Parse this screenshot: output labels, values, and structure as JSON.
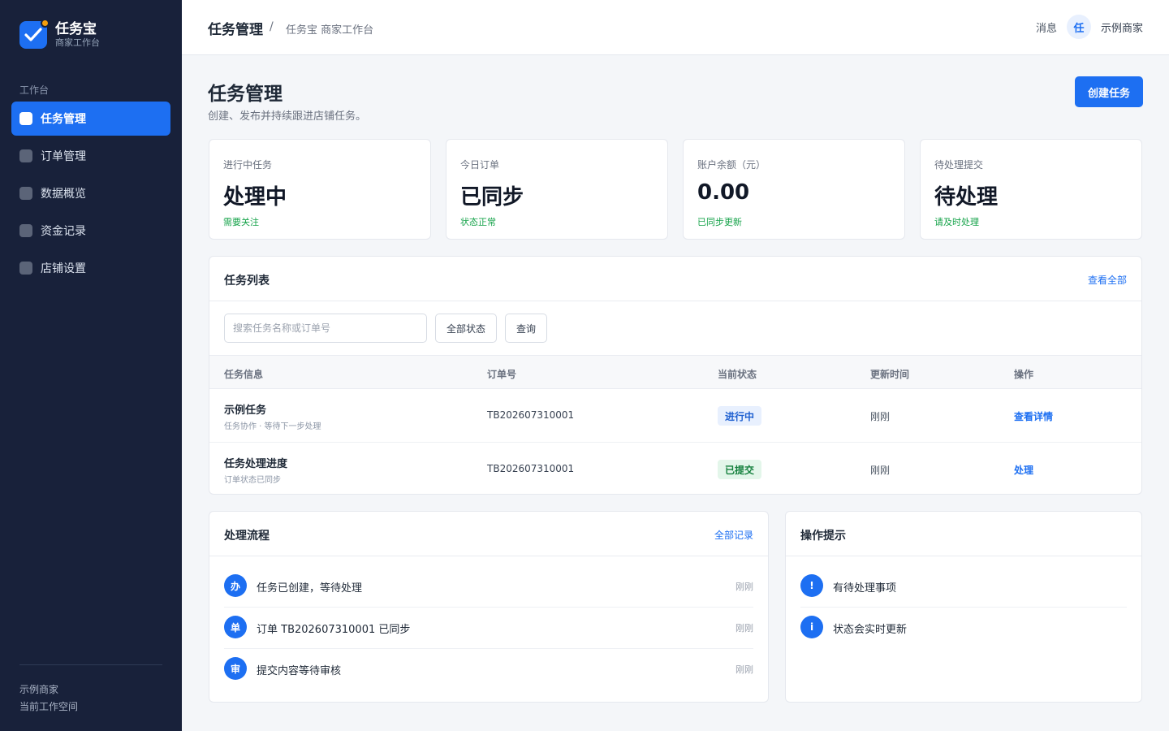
{
  "brand": {
    "name": "任务宝",
    "subtitle": "商家工作台"
  },
  "sidebar": {
    "section_label": "工作台",
    "items": [
      {
        "label": "任务管理",
        "active": true
      },
      {
        "label": "订单管理",
        "active": false
      },
      {
        "label": "数据概览",
        "active": false
      },
      {
        "label": "资金记录",
        "active": false
      },
      {
        "label": "店铺设置",
        "active": false
      }
    ],
    "footer": {
      "merchant": "示例商家",
      "workspace": "当前工作空间"
    }
  },
  "topbar": {
    "breadcrumb_main": "任务管理",
    "breadcrumb_sep": "/",
    "breadcrumb_sub": "任务宝 商家工作台",
    "messages": "消息",
    "avatar_char": "任",
    "user_name": "示例商家"
  },
  "page": {
    "title": "任务管理",
    "description": "创建、发布并持续跟进店铺任务。",
    "create_button": "创建任务"
  },
  "stats": [
    {
      "label": "进行中任务",
      "value": "处理中",
      "note": "需要关注"
    },
    {
      "label": "今日订单",
      "value": "已同步",
      "note": "状态正常"
    },
    {
      "label": "账户余额（元）",
      "value": "0.00",
      "note": "已同步更新"
    },
    {
      "label": "待处理提交",
      "value": "待处理",
      "note": "请及时处理"
    }
  ],
  "task_list": {
    "title": "任务列表",
    "view_all": "查看全部",
    "search_placeholder": "搜索任务名称或订单号",
    "status_filter": "全部状态",
    "query_button": "查询",
    "columns": [
      "任务信息",
      "订单号",
      "当前状态",
      "更新时间",
      "操作"
    ],
    "rows": [
      {
        "name": "示例任务",
        "desc": "任务协作 · 等待下一步处理",
        "order": "TB202607310001",
        "status": "进行中",
        "status_color": "blue",
        "time": "刚刚",
        "action": "查看详情"
      },
      {
        "name": "任务处理进度",
        "desc": "订单状态已同步",
        "order": "TB202607310001",
        "status": "已提交",
        "status_color": "green",
        "time": "刚刚",
        "action": "处理"
      }
    ]
  },
  "flow": {
    "title": "处理流程",
    "link": "全部记录",
    "items": [
      {
        "icon": "办",
        "text": "任务已创建，等待处理",
        "time": "刚刚"
      },
      {
        "icon": "单",
        "text": "订单 TB202607310001 已同步",
        "time": "刚刚"
      },
      {
        "icon": "审",
        "text": "提交内容等待审核",
        "time": "刚刚"
      }
    ]
  },
  "tips": {
    "title": "操作提示",
    "items": [
      {
        "icon": "!",
        "text": "有待处理事项"
      },
      {
        "icon": "i",
        "text": "状态会实时更新"
      }
    ]
  },
  "colors": {
    "sidebar_bg": "#18213a",
    "accent": "#1d6ff2",
    "success": "#16a34a"
  }
}
